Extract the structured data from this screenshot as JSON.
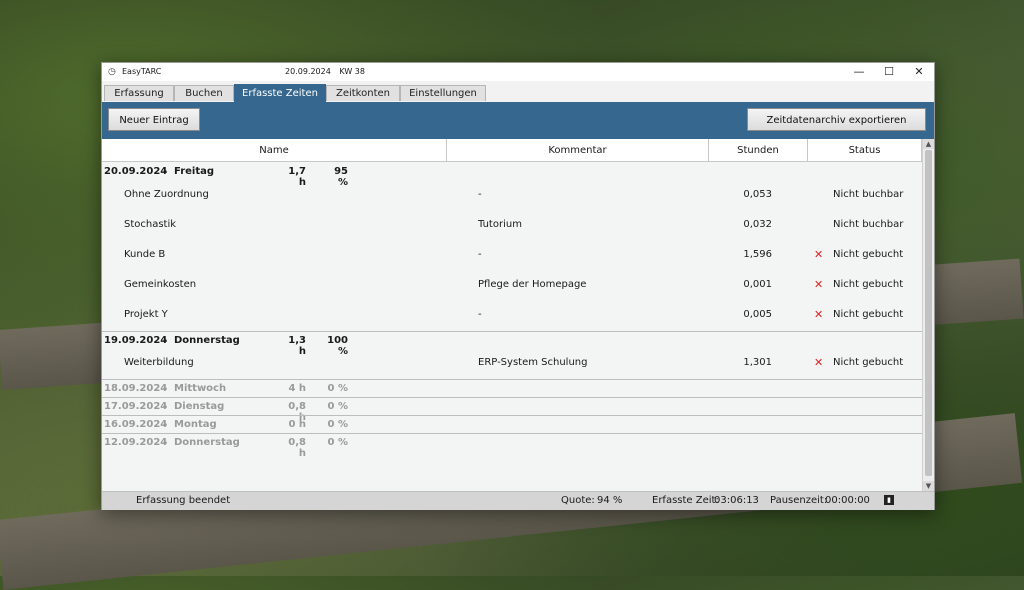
{
  "window": {
    "app_name": "EasyTARC",
    "date": "20.09.2024",
    "week": "KW 38",
    "controls": {
      "minimize": "—",
      "maximize": "☐",
      "close": "✕"
    }
  },
  "tabs": [
    {
      "label": "Erfassung"
    },
    {
      "label": "Buchen"
    },
    {
      "label": "Erfasste Zeiten",
      "active": true
    },
    {
      "label": "Zeitkonten"
    },
    {
      "label": "Einstellungen"
    }
  ],
  "toolbar": {
    "new_entry_label": "Neuer Eintrag",
    "export_label": "Zeitdatenarchiv exportieren"
  },
  "table": {
    "columns": {
      "name": "Name",
      "comment": "Kommentar",
      "hours": "Stunden",
      "status": "Status"
    },
    "groups": [
      {
        "date": "20.09.2024",
        "dash": "-",
        "day": "Freitag",
        "hours": "1,7 h",
        "quota": "95 %",
        "rows": [
          {
            "name": "Ohne Zuordnung",
            "comment": "-",
            "hours": "0,053",
            "status": "Nicht buchbar"
          },
          {
            "name": "Stochastik",
            "comment": "Tutorium",
            "hours": "0,032",
            "status": "Nicht buchbar"
          },
          {
            "name": "Kunde B",
            "comment": "-",
            "hours": "1,596",
            "status": "Nicht gebucht",
            "mark": "✕"
          },
          {
            "name": "Gemeinkosten",
            "comment": "Pflege der Homepage",
            "hours": "0,001",
            "status": "Nicht gebucht",
            "mark": "✕"
          },
          {
            "name": "Projekt Y",
            "comment": "-",
            "hours": "0,005",
            "status": "Nicht gebucht",
            "mark": "✕"
          }
        ]
      },
      {
        "date": "19.09.2024",
        "dash": "-",
        "day": "Donnerstag",
        "hours": "1,3 h",
        "quota": "100 %",
        "rows": [
          {
            "name": "Weiterbildung",
            "comment": "ERP-System Schulung",
            "hours": "1,301",
            "status": "Nicht gebucht",
            "mark": "✕"
          }
        ]
      },
      {
        "date": "18.09.2024",
        "dash": "-",
        "day": "Mittwoch",
        "hours": "4 h",
        "quota": "0 %"
      },
      {
        "date": "17.09.2024",
        "dash": "-",
        "day": "Dienstag",
        "hours": "0,8 h",
        "quota": "0 %"
      },
      {
        "date": "16.09.2024",
        "dash": "-",
        "day": "Montag",
        "hours": "0 h",
        "quota": "0 %"
      },
      {
        "date": "12.09.2024",
        "dash": "-",
        "day": "Donnerstag",
        "hours": "0,8 h",
        "quota": "0 %"
      }
    ]
  },
  "statusbar": {
    "state": "Erfassung beendet",
    "quota_label": "Quote:",
    "quota_value": "94 %",
    "tracked_label": "Erfasste Zeit:",
    "tracked_value": "03:06:13",
    "pause_label": "Pausenzeit:",
    "pause_value": "00:00:00",
    "icon": "chart-icon"
  },
  "colors": {
    "accent": "#36678f",
    "not_booked_mark": "#e0201f",
    "muted_group": "#9a9a9a"
  }
}
